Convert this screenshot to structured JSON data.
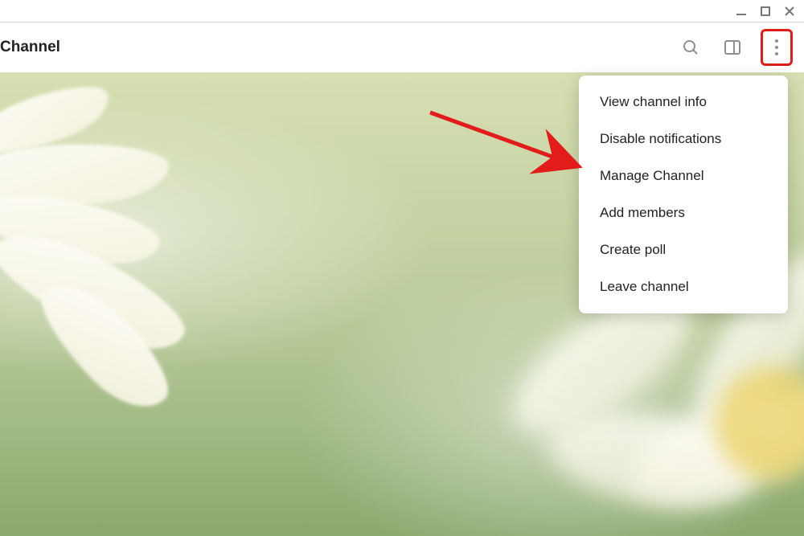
{
  "header": {
    "title": "Channel"
  },
  "toolbar": {
    "icons": {
      "search": "search-icon",
      "panel": "side-panel-icon",
      "more": "more-vert-icon"
    }
  },
  "menu": {
    "items": [
      {
        "label": "View channel info"
      },
      {
        "label": "Disable notifications"
      },
      {
        "label": "Manage Channel"
      },
      {
        "label": "Add members"
      },
      {
        "label": "Create poll"
      },
      {
        "label": "Leave channel"
      }
    ]
  },
  "annotation": {
    "highlight_target": "more-button",
    "arrow_color": "#e21b1b",
    "arrow_points_to": "Manage Channel"
  }
}
